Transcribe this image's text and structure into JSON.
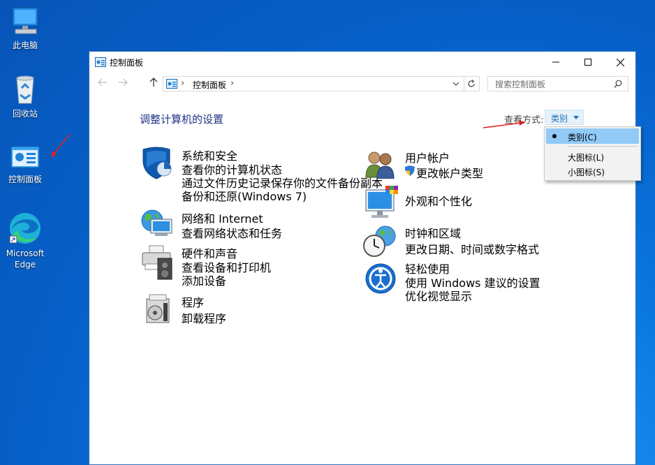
{
  "desktop": {
    "icons": [
      {
        "label": "此电脑",
        "icon": "computer-icon"
      },
      {
        "label": "回收站",
        "icon": "recycle-bin-icon"
      },
      {
        "label": "控制面板",
        "icon": "control-panel-icon"
      },
      {
        "label": "Microsoft\nEdge",
        "icon": "edge-icon"
      }
    ]
  },
  "window": {
    "title": "控制面板",
    "controls": {
      "minimize": "minimize-icon",
      "maximize": "maximize-icon",
      "close": "close-icon"
    }
  },
  "address_bar": {
    "path": "控制面板",
    "separator": "›"
  },
  "search": {
    "placeholder": "搜索控制面板"
  },
  "main": {
    "heading": "调整计算机的设置",
    "view_by_label": "查看方式:",
    "view_by_value": "类别",
    "categories_left": [
      {
        "title": "系统和安全",
        "icon": "system-security-icon",
        "links": [
          "查看你的计算机状态",
          "通过文件历史记录保存你的文件备份副本",
          "备份和还原(Windows 7)"
        ]
      },
      {
        "title": "网络和 Internet",
        "icon": "network-icon",
        "links": [
          "查看网络状态和任务"
        ]
      },
      {
        "title": "硬件和声音",
        "icon": "hardware-sound-icon",
        "links": [
          "查看设备和打印机",
          "添加设备"
        ]
      },
      {
        "title": "程序",
        "icon": "programs-icon",
        "links": [
          "卸载程序"
        ]
      }
    ],
    "categories_right": [
      {
        "title": "用户帐户",
        "icon": "user-accounts-icon",
        "links": [
          "更改帐户类型"
        ]
      },
      {
        "title": "外观和个性化",
        "icon": "appearance-icon",
        "links": []
      },
      {
        "title": "时钟和区域",
        "icon": "clock-region-icon",
        "links": [
          "更改日期、时间或数字格式"
        ]
      },
      {
        "title": "轻松使用",
        "icon": "ease-of-access-icon",
        "links": [
          "使用 Windows 建议的设置",
          "优化视觉显示"
        ]
      }
    ]
  },
  "dropdown": {
    "items": [
      {
        "label": "类别(C)",
        "selected": true
      },
      {
        "label": "大图标(L)",
        "selected": false
      },
      {
        "label": "小图标(S)",
        "selected": false
      }
    ]
  },
  "colors": {
    "category_title": "#0a7a1f",
    "link": "#1f55c8",
    "heading": "#1e3287",
    "annotation_arrow": "#e02020"
  }
}
